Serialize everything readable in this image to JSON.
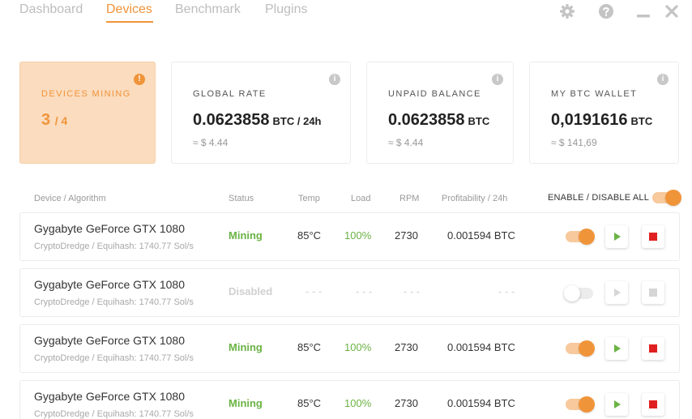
{
  "nav": {
    "tabs": [
      {
        "label": "Dashboard"
      },
      {
        "label": "Devices"
      },
      {
        "label": "Benchmark"
      },
      {
        "label": "Plugins"
      }
    ],
    "active_tab": "Devices",
    "icons": [
      "gear-icon",
      "help-icon",
      "minimize-icon",
      "close-icon"
    ]
  },
  "cards": {
    "devices_mining": {
      "label": "DEVICES MINING",
      "value": "3",
      "suffix": "/ 4",
      "info": "!"
    },
    "global_rate": {
      "label": "GLOBAL RATE",
      "value": "0.0623858",
      "unit": "BTC  / 24h",
      "approx": "≈ $ 4.44",
      "info": "i"
    },
    "unpaid_balance": {
      "label": "UNPAID BALANCE",
      "value": "0.0623858",
      "unit": "BTC",
      "approx": "≈ $ 4.44",
      "info": "i"
    },
    "btc_wallet": {
      "label": "MY BTC WALLET",
      "value": "0,0191616",
      "unit": "BTC",
      "approx": "≈ $ 141,69",
      "info": "i"
    }
  },
  "table": {
    "headers": {
      "device": "Device / Algorithm",
      "status": "Status",
      "temp": "Temp",
      "load": "Load",
      "rpm": "RPM",
      "profit": "Profitability / 24h",
      "enable_all": "ENABLE / DISABLE ALL"
    },
    "enable_all_on": true,
    "rows": [
      {
        "name": "Gygabyte GeForce GTX 1080",
        "algo": "CryptoDredge / Equihash: 1740.77 Sol/s",
        "status": "Mining",
        "temp": "85°C",
        "load": "100%",
        "rpm": "2730",
        "profit": "0.001594 BTC",
        "enabled": true
      },
      {
        "name": "Gygabyte GeForce GTX 1080",
        "algo": "CryptoDredge / Equihash: 1740.77 Sol/s",
        "status": "Disabled",
        "temp": "- - -",
        "load": "- - -",
        "rpm": "- - -",
        "profit": "- - -",
        "enabled": false
      },
      {
        "name": "Gygabyte GeForce GTX 1080",
        "algo": "CryptoDredge / Equihash: 1740.77 Sol/s",
        "status": "Mining",
        "temp": "85°C",
        "load": "100%",
        "rpm": "2730",
        "profit": "0.001594 BTC",
        "enabled": true
      },
      {
        "name": "Gygabyte GeForce GTX 1080",
        "algo": "CryptoDredge / Equihash: 1740.77 Sol/s",
        "status": "Mining",
        "temp": "85°C",
        "load": "100%",
        "rpm": "2730",
        "profit": "0.001594 BTC",
        "enabled": true
      }
    ]
  },
  "colors": {
    "accent": "#f0943a",
    "mining": "#6ab344",
    "stop": "#e02020"
  }
}
